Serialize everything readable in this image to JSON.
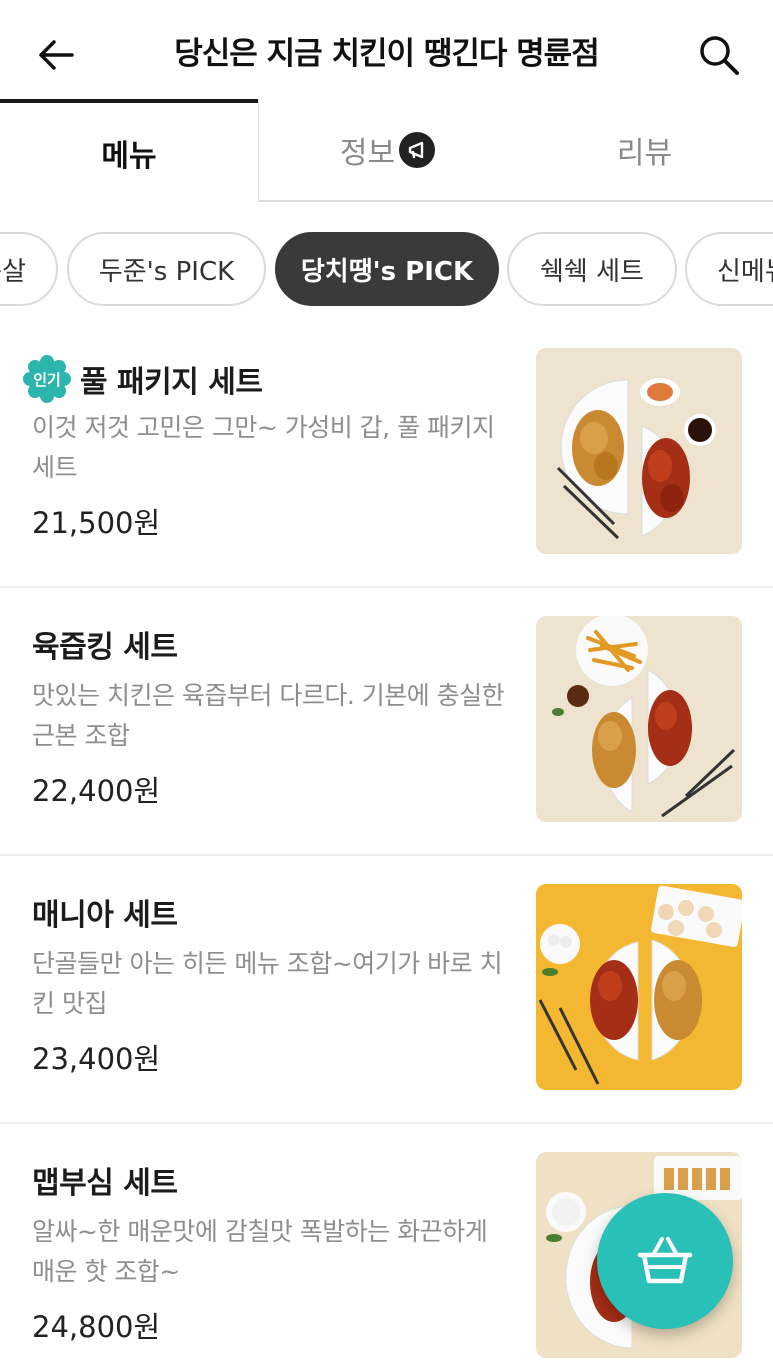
{
  "header": {
    "title": "당신은 지금 치킨이 땡긴다 명륜점",
    "back_icon": "arrow-left-icon",
    "search_icon": "search-icon"
  },
  "tabs": [
    {
      "label": "메뉴",
      "active": true
    },
    {
      "label": "정보",
      "active": false,
      "icon": "megaphone-icon"
    },
    {
      "label": "리뷰",
      "active": false
    }
  ],
  "chips": [
    {
      "label": "순살",
      "active": false
    },
    {
      "label": "두준's PICK",
      "active": false
    },
    {
      "label": "당치땡's PICK",
      "active": true
    },
    {
      "label": "쉑쉑 세트",
      "active": false
    },
    {
      "label": "신메뉴",
      "active": false
    }
  ],
  "menu_items": [
    {
      "name": "풀 패키지 세트",
      "badge": "인기",
      "description": "이것 저것 고민은 그만~ 가성비 갑, 풀 패키지 세트",
      "price": "21,500원"
    },
    {
      "name": "육즙킹 세트",
      "description": "맛있는 치킨은 육즙부터 다르다. 기본에 충실한 근본 조합",
      "price": "22,400원"
    },
    {
      "name": "매니아 세트",
      "description": "단골들만 아는 히든 메뉴 조합~여기가 바로 치킨 맛집",
      "price": "23,400원"
    },
    {
      "name": "맵부심 세트",
      "description": "알싸~한 매운맛에 감칠맛 폭발하는 화끈하게 매운 핫 조합~",
      "price": "24,800원"
    }
  ],
  "cart": {
    "icon": "basket-icon"
  },
  "colors": {
    "accent": "#28c0b7",
    "active_chip": "#3a3a3a",
    "badge": "#2bb5ad"
  }
}
